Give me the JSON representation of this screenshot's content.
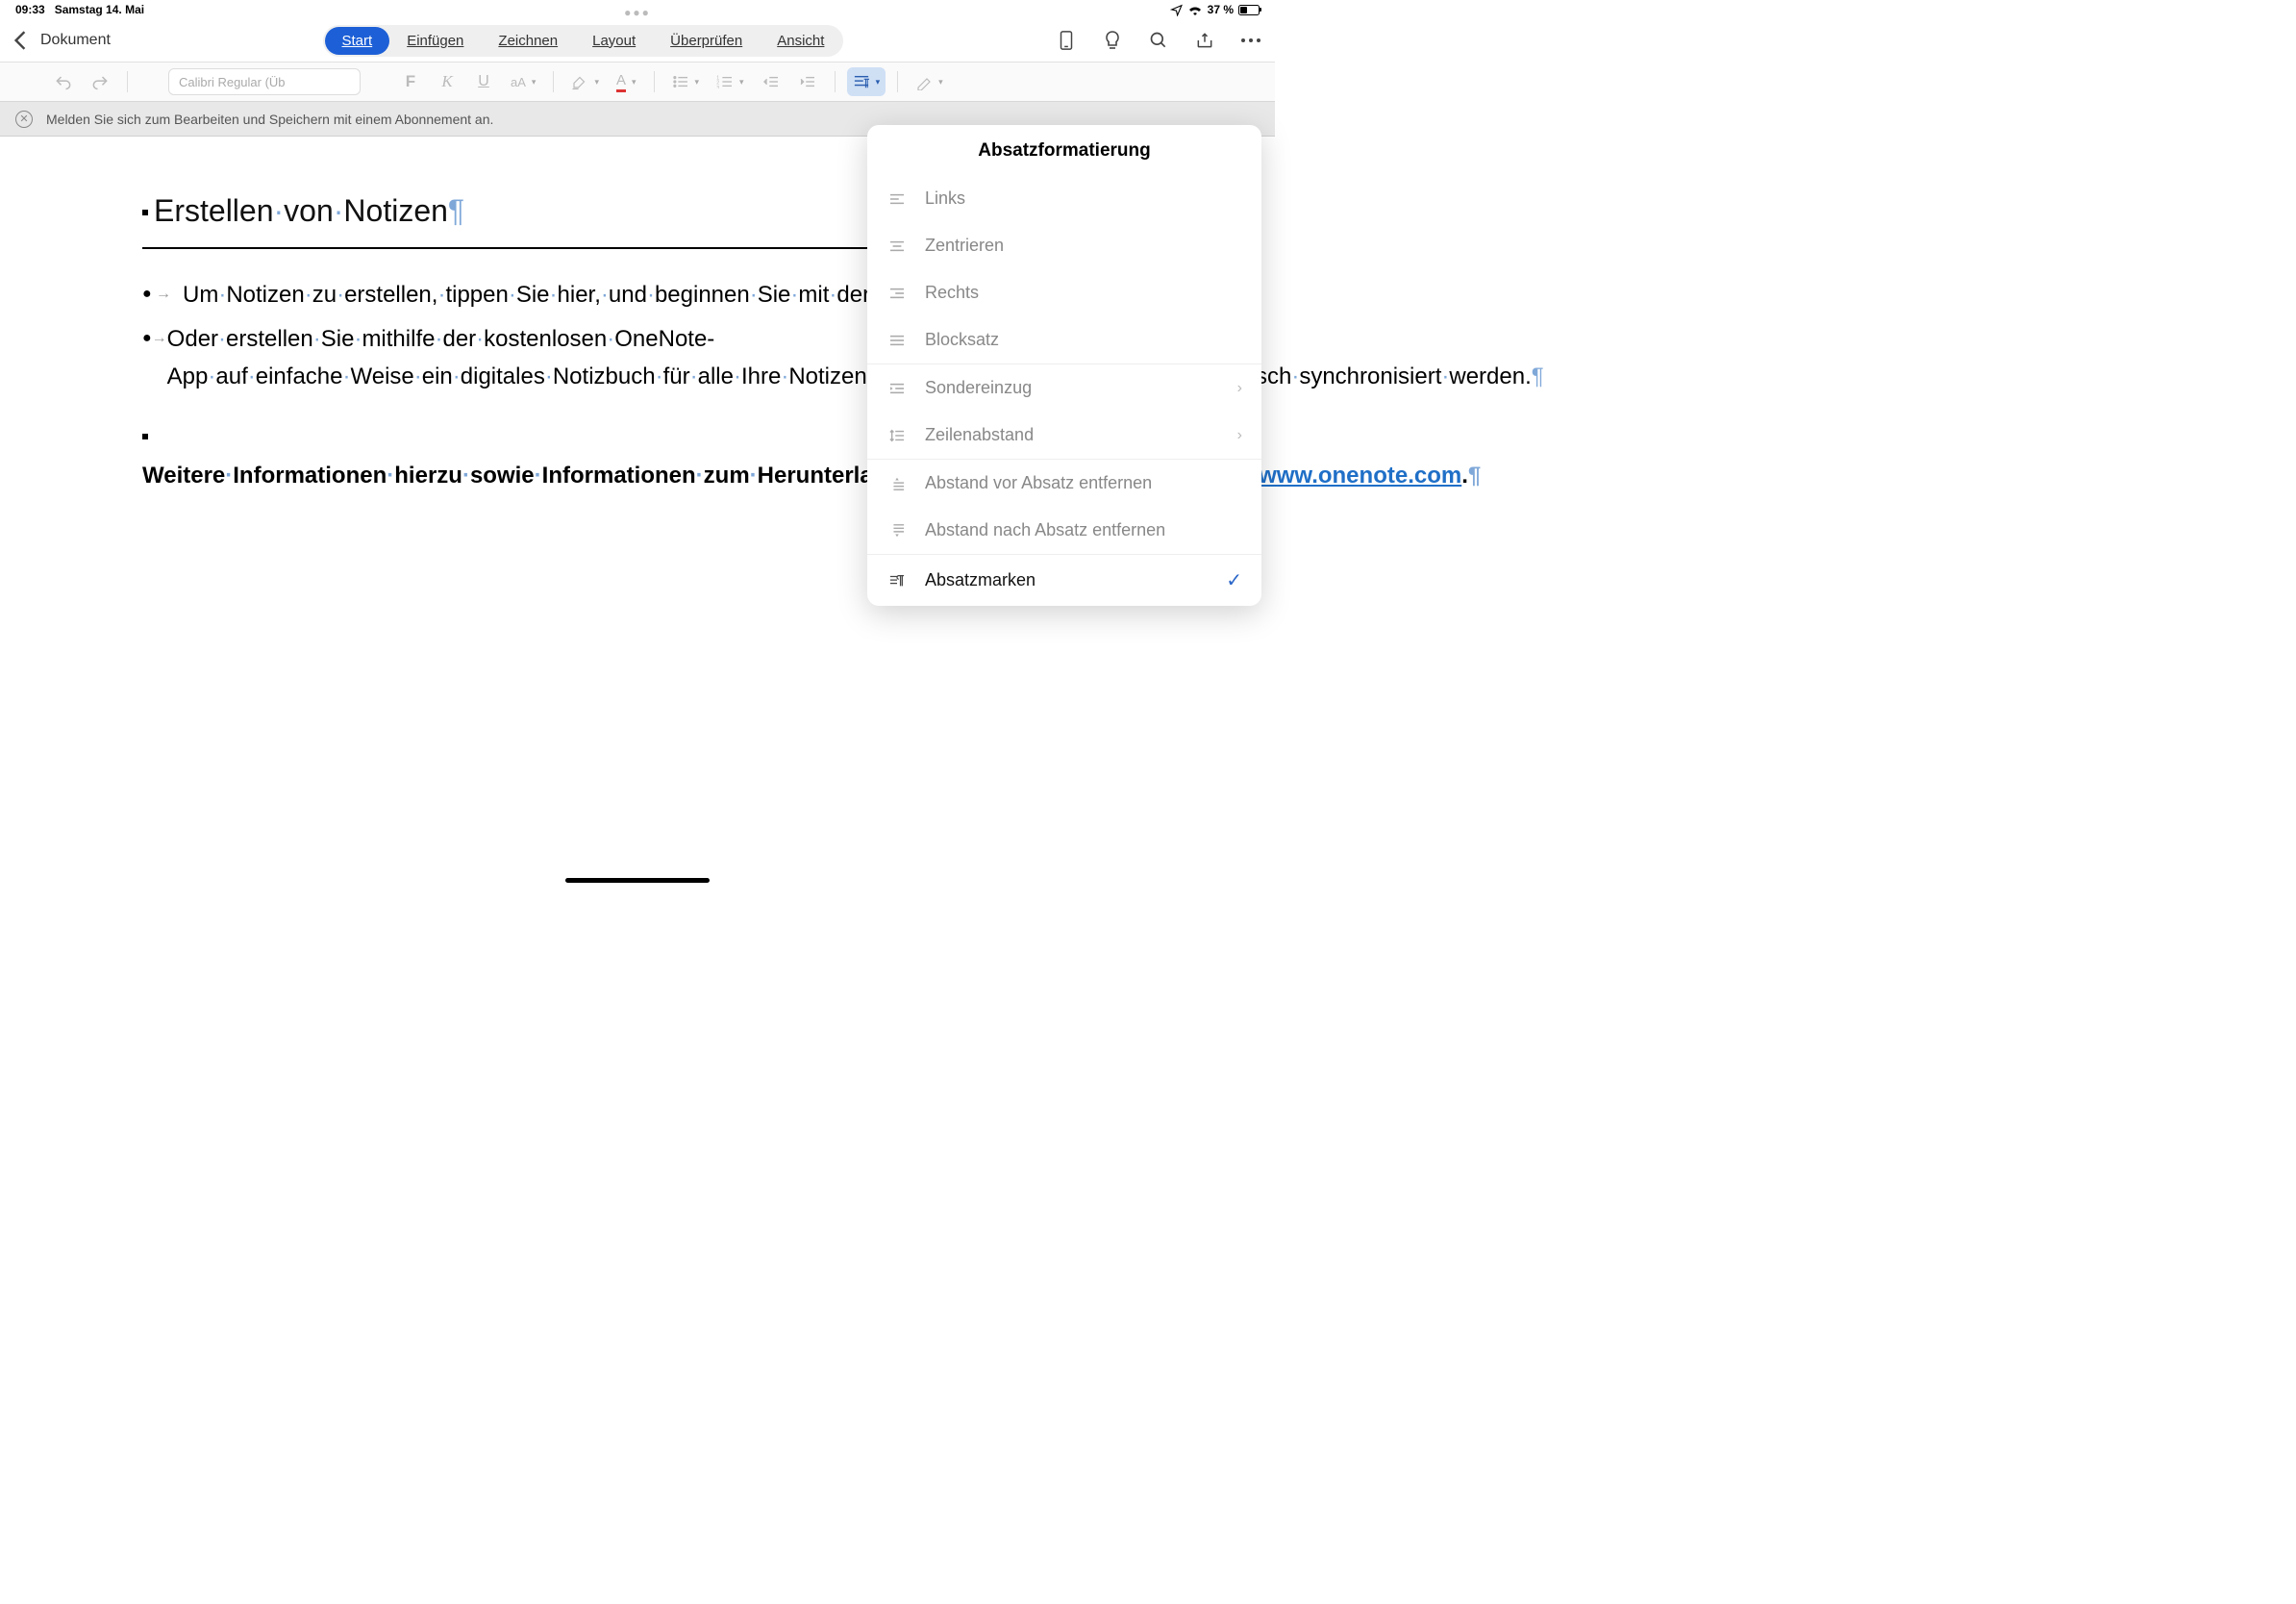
{
  "status": {
    "time": "09:33",
    "date": "Samstag 14. Mai",
    "battery": "37 %"
  },
  "header": {
    "back_doc": "Dokument",
    "tabs": [
      "Start",
      "Einfügen",
      "Zeichnen",
      "Layout",
      "Überprüfen",
      "Ansicht"
    ]
  },
  "toolbar": {
    "font": "Calibri Regular (Üb"
  },
  "infobar": {
    "msg": "Melden Sie sich zum Bearbeiten und Speichern mit einem Abonnement an."
  },
  "doc": {
    "title": "Erstellen·von·Notizen",
    "b1": "Um·Notizen·zu·erstellen,·tippen·Sie·hier,·und·beginnen·Sie·mit·der·Eingabe.",
    "b2": "Oder·erstellen·Sie·mithilfe·der·kostenlosen·OneNote-App·auf·einfache·Weise·ein·digitales·Notizbuch·für·alle·Ihre·Notizen,·die·auf·allen·Ihren·Geräten·automatisch·synchronisiert·werden.",
    "p_pre": "Weitere·Informationen·hierzu·sowie·Informationen·zum·Herunterladen·von·OneNote·finden·Sie·unter·",
    "link": "www.onenote.com",
    "p_post": "."
  },
  "popover": {
    "title": "Absatzformatierung",
    "items": [
      {
        "label": "Links",
        "icon": "align-left",
        "enabled": false
      },
      {
        "label": "Zentrieren",
        "icon": "align-center",
        "enabled": false
      },
      {
        "label": "Rechts",
        "icon": "align-right",
        "enabled": false
      },
      {
        "label": "Blocksatz",
        "icon": "align-justify",
        "enabled": false
      },
      {
        "label": "Sondereinzug",
        "icon": "indent-special",
        "enabled": false,
        "arrow": true,
        "divider": true
      },
      {
        "label": "Zeilenabstand",
        "icon": "line-spacing",
        "enabled": false,
        "arrow": true
      },
      {
        "label": "Abstand vor Absatz entfernen",
        "icon": "space-before",
        "enabled": false,
        "divider": true
      },
      {
        "label": "Abstand nach Absatz entfernen",
        "icon": "space-after",
        "enabled": false
      },
      {
        "label": "Absatzmarken",
        "icon": "pilcrow",
        "enabled": true,
        "check": true,
        "divider": true
      }
    ]
  }
}
